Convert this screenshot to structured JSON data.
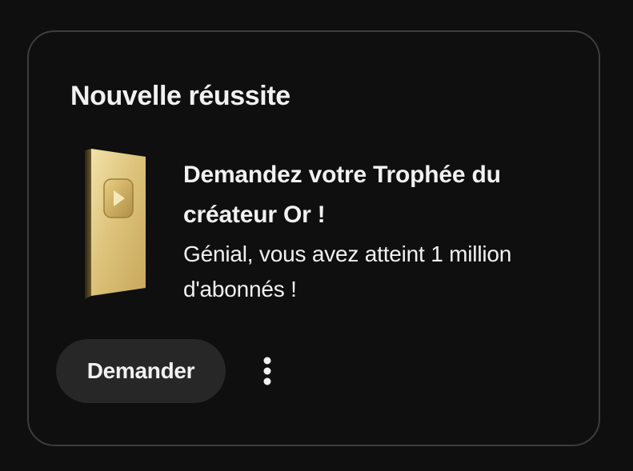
{
  "card": {
    "title": "Nouvelle réussite",
    "headline": "Demandez votre Trophée du créateur Or !",
    "description": "Génial, vous avez atteint 1 million d'abonnés !",
    "claim_label": "Demander",
    "more_icon": "more-vertical-icon",
    "trophy_icon": "gold-creator-award-icon"
  },
  "colors": {
    "background": "#0f0f0f",
    "card_border": "#3d3d3d",
    "text": "#f1f1f1",
    "button_bg": "#272727",
    "trophy_gold": "#d9bf73"
  }
}
